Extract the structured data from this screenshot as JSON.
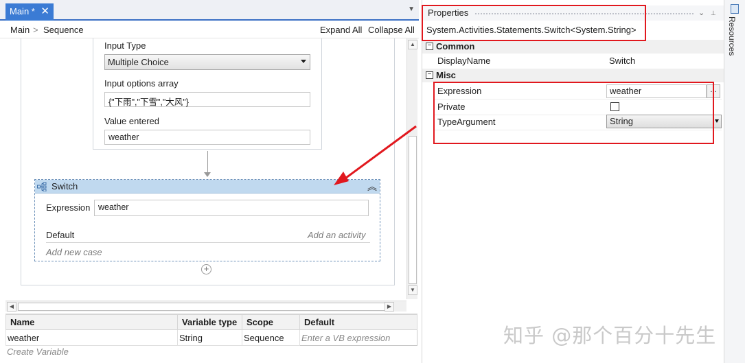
{
  "tab": {
    "title": "Main *",
    "close_glyph": "✕"
  },
  "breadcrumb": {
    "main": "Main",
    "separator": ">",
    "sequence": "Sequence",
    "expand_all": "Expand All",
    "collapse_all": "Collapse All"
  },
  "input_activity": {
    "input_type_label": "Input Type",
    "input_type_value": "Multiple Choice",
    "options_label": "Input options array",
    "options_value": "{\"下雨\",\"下雪\",\"大风\"}",
    "value_label": "Value entered",
    "value_value": "weather"
  },
  "switch_activity": {
    "title": "Switch",
    "expression_label": "Expression",
    "expression_value": "weather",
    "default_label": "Default",
    "add_activity_hint": "Add an activity",
    "add_case_hint": "Add new case",
    "add_glyph": "+",
    "collapse_glyph": "︽"
  },
  "variables": {
    "headers": [
      "Name",
      "Variable type",
      "Scope",
      "Default"
    ],
    "rows": [
      {
        "name": "weather",
        "type": "String",
        "scope": "Sequence",
        "default": "Enter a VB expression"
      }
    ],
    "create_hint": "Create Variable"
  },
  "properties": {
    "title": "Properties",
    "type_line": "System.Activities.Statements.Switch<System.String>",
    "categories": {
      "common": {
        "name": "Common",
        "toggle": "−"
      },
      "misc": {
        "name": "Misc",
        "toggle": "−"
      }
    },
    "display_name": {
      "name": "DisplayName",
      "value": "Switch"
    },
    "expression": {
      "name": "Expression",
      "value": "weather",
      "button": "..."
    },
    "private": {
      "name": "Private",
      "checked": false
    },
    "type_argument": {
      "name": "TypeArgument",
      "value": "String"
    },
    "controls": {
      "dropdown": "⌄",
      "pin": "📌"
    }
  },
  "resources": {
    "label": "Resources"
  },
  "watermark": "知乎 @那个百分十先生",
  "colors": {
    "accent": "#3b7bd4",
    "highlight": "#e1181e",
    "switch_header": "#c0d9ef"
  }
}
